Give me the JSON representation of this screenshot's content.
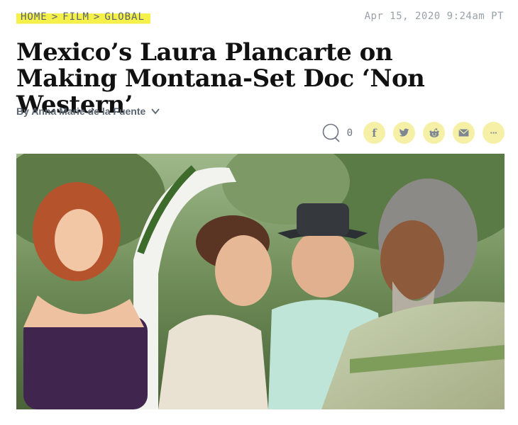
{
  "breadcrumb": {
    "items": [
      "HOME",
      "FILM",
      "GLOBAL"
    ],
    "separator": ">"
  },
  "timestamp": "Apr 15, 2020 9:24am PT",
  "headline": "Mexico’s Laura Plancarte on Making Montana-Set Doc ‘Non Western’",
  "byline": "By Anna Marie de la Fuente",
  "social": {
    "comment_count": "0",
    "buttons": [
      {
        "name": "facebook",
        "icon": "facebook-icon",
        "glyph": "f"
      },
      {
        "name": "twitter",
        "icon": "twitter-icon",
        "glyph": ""
      },
      {
        "name": "reddit",
        "icon": "reddit-icon",
        "glyph": ""
      },
      {
        "name": "email",
        "icon": "email-icon",
        "glyph": ""
      },
      {
        "name": "more",
        "icon": "more-icon",
        "glyph": "···"
      }
    ]
  },
  "colors": {
    "highlight": "#f6f04a",
    "social_bg": "#f6f0a6",
    "meta_text": "#5a6470"
  },
  "hero": {
    "description_icon": "hero-photo"
  }
}
